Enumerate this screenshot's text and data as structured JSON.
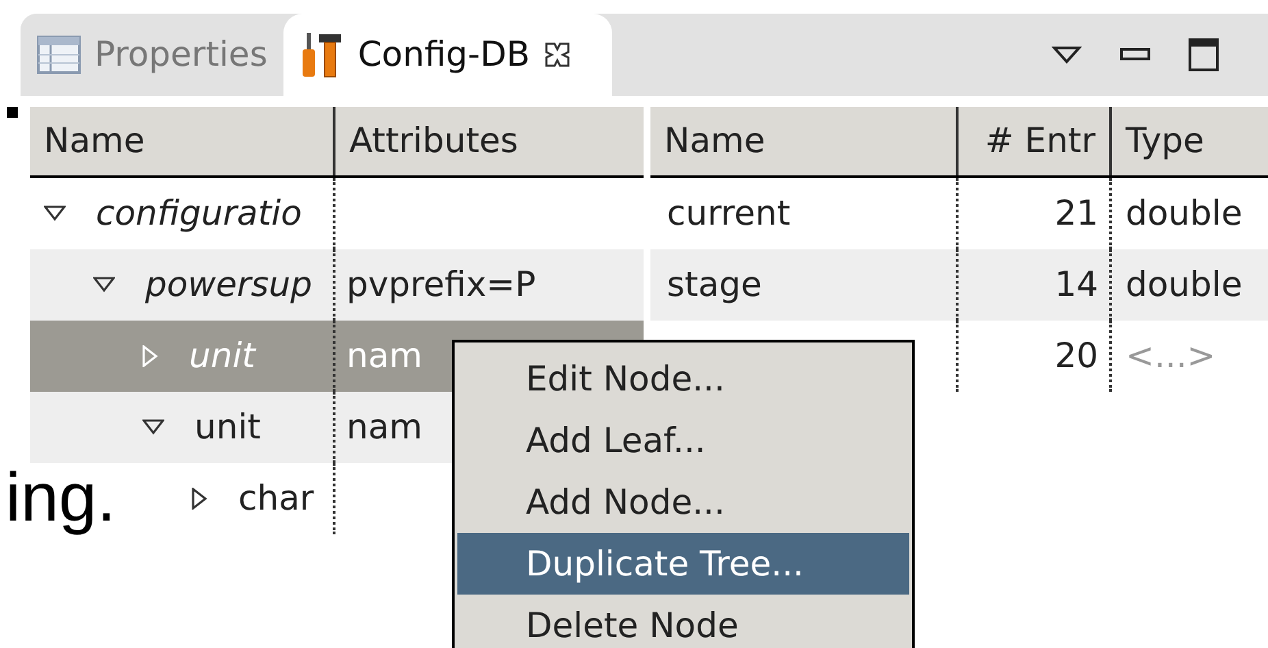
{
  "tabs": [
    {
      "label": "Properties",
      "selected": false
    },
    {
      "label": "Config-DB",
      "selected": true
    }
  ],
  "tree": {
    "columns": [
      "Name",
      "Attributes"
    ],
    "nodes": [
      {
        "name": "configuratio",
        "italic": true,
        "expanded": true,
        "selected": false,
        "children": [
          {
            "name": "powersup",
            "attributes": "pvprefix=P",
            "italic": true,
            "expanded": true,
            "selected": false,
            "children": [
              {
                "name": "unit",
                "attributes": "nam",
                "italic": true,
                "expanded": false,
                "selected": true
              },
              {
                "name": "unit",
                "attributes": "nam",
                "italic": false,
                "expanded": true,
                "selected": false,
                "children": [
                  {
                    "name": "char",
                    "italic": false,
                    "expanded": false,
                    "selected": false
                  }
                ]
              }
            ]
          }
        ]
      }
    ]
  },
  "details": {
    "columns": [
      "Name",
      "# Entr",
      "Type"
    ],
    "rows": [
      {
        "name": "current",
        "entries": "21",
        "type": "double",
        "type_undefined": false
      },
      {
        "name": "stage",
        "entries": "14",
        "type": "double",
        "type_undefined": false
      },
      {
        "entries": "20",
        "type": "<...>",
        "type_undefined": true
      }
    ]
  },
  "background_text": "ing.",
  "context_menu": [
    {
      "label": "Edit Node...",
      "selected": false
    },
    {
      "label": "Add Leaf...",
      "selected": false
    },
    {
      "label": "Add Node...",
      "selected": false
    },
    {
      "label": "Duplicate Tree...",
      "selected": true
    },
    {
      "label": "Delete Node",
      "selected": false
    }
  ]
}
